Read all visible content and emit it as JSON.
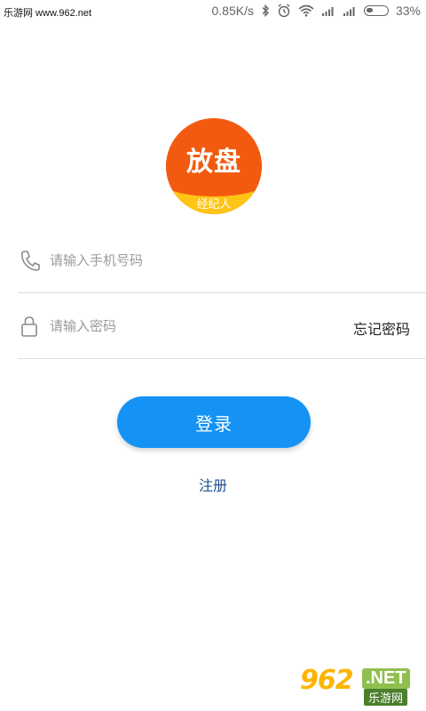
{
  "status_bar": {
    "left_text": "乐游网 www.962.net",
    "speed": "0.85K/s",
    "battery": "33%",
    "battery_level": 0.33
  },
  "logo": {
    "main_text": "放盘",
    "sub_text": "经纪人",
    "colors": {
      "top": "#f25a0f",
      "bottom": "#ffc415"
    }
  },
  "form": {
    "phone": {
      "placeholder": "请输入手机号码",
      "value": "",
      "icon": "phone-icon"
    },
    "password": {
      "placeholder": "请输入密码",
      "value": "",
      "icon": "lock-icon"
    },
    "forgot_label": "忘记密码"
  },
  "login_button": {
    "label": "登录",
    "color": "#1493f5"
  },
  "register_label": "注册",
  "watermark": {
    "number": "962",
    "suffix": ".NET",
    "cn": "乐游网"
  }
}
